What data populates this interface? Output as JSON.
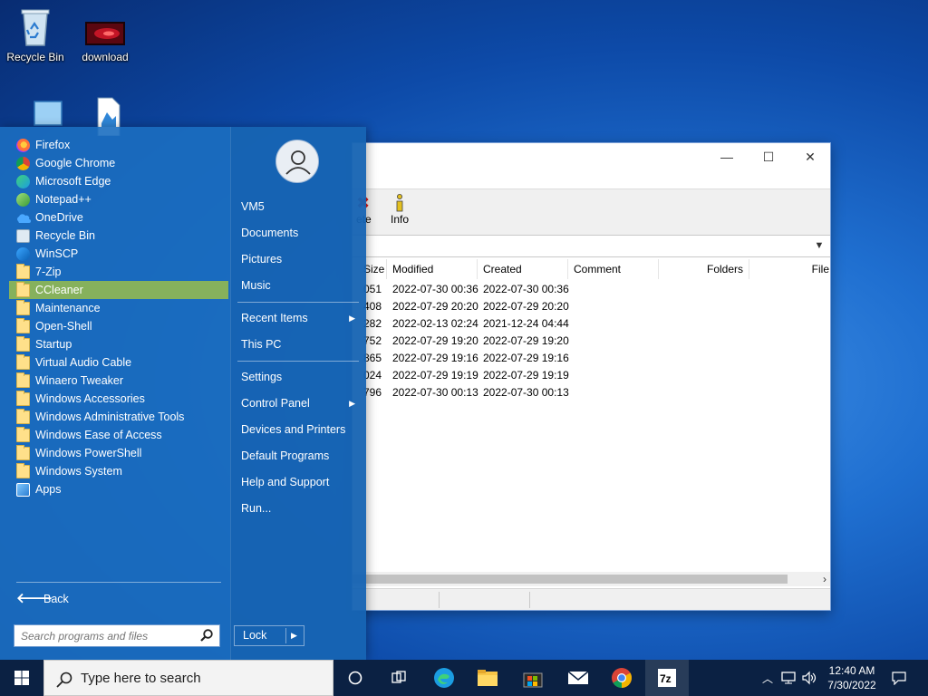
{
  "desktop": {
    "icons": [
      {
        "label": "Recycle Bin"
      },
      {
        "label": "download"
      },
      {
        "label": ""
      },
      {
        "label": ""
      }
    ]
  },
  "sevenzip": {
    "toolbar": {
      "delete_label": "ete",
      "info_label": "Info"
    },
    "columns": [
      "Size",
      "Modified",
      "Created",
      "Comment",
      "Folders",
      "File"
    ],
    "rows": [
      {
        "size": "051",
        "modified": "2022-07-30 00:36",
        "created": "2022-07-30 00:36"
      },
      {
        "size": "408",
        "modified": "2022-07-29 20:20",
        "created": "2022-07-29 20:20"
      },
      {
        "size": "282",
        "modified": "2022-02-13 02:24",
        "created": "2021-12-24 04:44"
      },
      {
        "size": "752",
        "modified": "2022-07-29 19:20",
        "created": "2022-07-29 19:20"
      },
      {
        "size": "865",
        "modified": "2022-07-29 19:16",
        "created": "2022-07-29 19:16"
      },
      {
        "size": "024",
        "modified": "2022-07-29 19:19",
        "created": "2022-07-29 19:19"
      },
      {
        "size": "796",
        "modified": "2022-07-30 00:13",
        "created": "2022-07-30 00:13"
      }
    ]
  },
  "start_menu": {
    "programs": [
      {
        "label": "Firefox",
        "icon": "firefox-icon"
      },
      {
        "label": "Google Chrome",
        "icon": "chrome-icon"
      },
      {
        "label": "Microsoft Edge",
        "icon": "edge-icon"
      },
      {
        "label": "Notepad++",
        "icon": "notepadpp-icon"
      },
      {
        "label": "OneDrive",
        "icon": "onedrive-icon"
      },
      {
        "label": "Recycle Bin",
        "icon": "recycle-bin-icon"
      },
      {
        "label": "WinSCP",
        "icon": "winscp-icon"
      },
      {
        "label": "7-Zip",
        "icon": "folder-icon"
      },
      {
        "label": "CCleaner",
        "icon": "folder-icon",
        "selected": true
      },
      {
        "label": "Maintenance",
        "icon": "folder-icon"
      },
      {
        "label": "Open-Shell",
        "icon": "folder-icon"
      },
      {
        "label": "Startup",
        "icon": "folder-icon"
      },
      {
        "label": "Virtual Audio Cable",
        "icon": "folder-icon"
      },
      {
        "label": "Winaero Tweaker",
        "icon": "folder-icon"
      },
      {
        "label": "Windows Accessories",
        "icon": "folder-icon"
      },
      {
        "label": "Windows Administrative Tools",
        "icon": "folder-icon"
      },
      {
        "label": "Windows Ease of Access",
        "icon": "folder-icon"
      },
      {
        "label": "Windows PowerShell",
        "icon": "folder-icon"
      },
      {
        "label": "Windows System",
        "icon": "folder-icon"
      },
      {
        "label": "Apps",
        "icon": "apps-icon"
      }
    ],
    "back_label": "Back",
    "search_placeholder": "Search programs and files",
    "right_items": {
      "user": "VM5",
      "documents": "Documents",
      "pictures": "Pictures",
      "music": "Music",
      "recent": "Recent Items",
      "this_pc": "This PC",
      "settings": "Settings",
      "control_panel": "Control Panel",
      "devices": "Devices and Printers",
      "default_programs": "Default Programs",
      "help": "Help and Support",
      "run": "Run..."
    },
    "lock_label": "Lock"
  },
  "taskbar": {
    "search_text": "Type here to search",
    "apps": [
      "task-view-icon",
      "edge-icon",
      "file-explorer-icon",
      "store-icon",
      "mail-icon",
      "chrome-icon",
      "7zip-icon"
    ],
    "time": "12:40 AM",
    "date": "7/30/2022"
  },
  "colors": {
    "start_menu_bg": "#1b6ec0",
    "selected_item": "#86b15c",
    "taskbar": "#0b2143"
  }
}
